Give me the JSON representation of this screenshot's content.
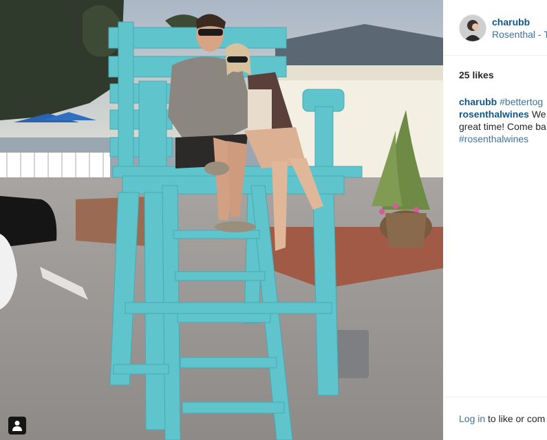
{
  "post": {
    "username": "charubb",
    "location": "Rosenthal - T",
    "likes": "25 likes",
    "caption_user": "charubb",
    "caption_tag": "#bettertog",
    "comment_user": "rosenthalwines",
    "comment_line1": "We",
    "comment_line2": "great time! Come ba",
    "comment_tag": "#rosenthalwines",
    "login_link": "Log in",
    "login_rest": "to like or com"
  },
  "icons": {
    "user_badge": "person-icon",
    "avatar": "profile-avatar"
  },
  "colors": {
    "link_dark": "#125688",
    "link": "#3f729b",
    "text": "#262626",
    "chair": "#5fc4cc"
  }
}
